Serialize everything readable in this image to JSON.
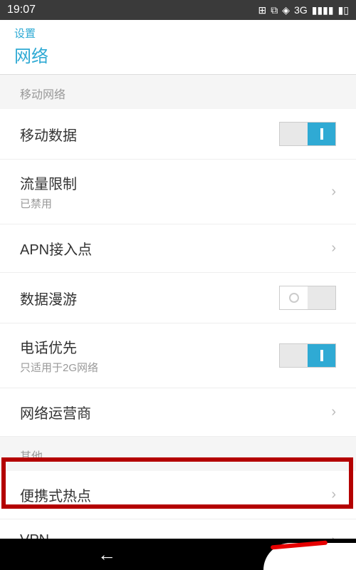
{
  "status": {
    "time": "19:07",
    "icons": {
      "qr": "▦",
      "image": "🖼",
      "wifi": "⊚",
      "network": "3G",
      "signal": "📶",
      "battery": "▮◧"
    }
  },
  "header": {
    "breadcrumb": "设置",
    "title": "网络"
  },
  "sections": [
    {
      "label": "移动网络"
    },
    {
      "label": "其他"
    }
  ],
  "items": {
    "mobile_data": {
      "title": "移动数据"
    },
    "data_limit": {
      "title": "流量限制",
      "subtitle": "已禁用"
    },
    "apn": {
      "title": "APN接入点"
    },
    "roaming": {
      "title": "数据漫游"
    },
    "call_priority": {
      "title": "电话优先",
      "subtitle": "只适用于2G网络"
    },
    "carrier": {
      "title": "网络运营商"
    },
    "hotspot": {
      "title": "便携式热点"
    },
    "vpn": {
      "title": "VPN"
    }
  }
}
